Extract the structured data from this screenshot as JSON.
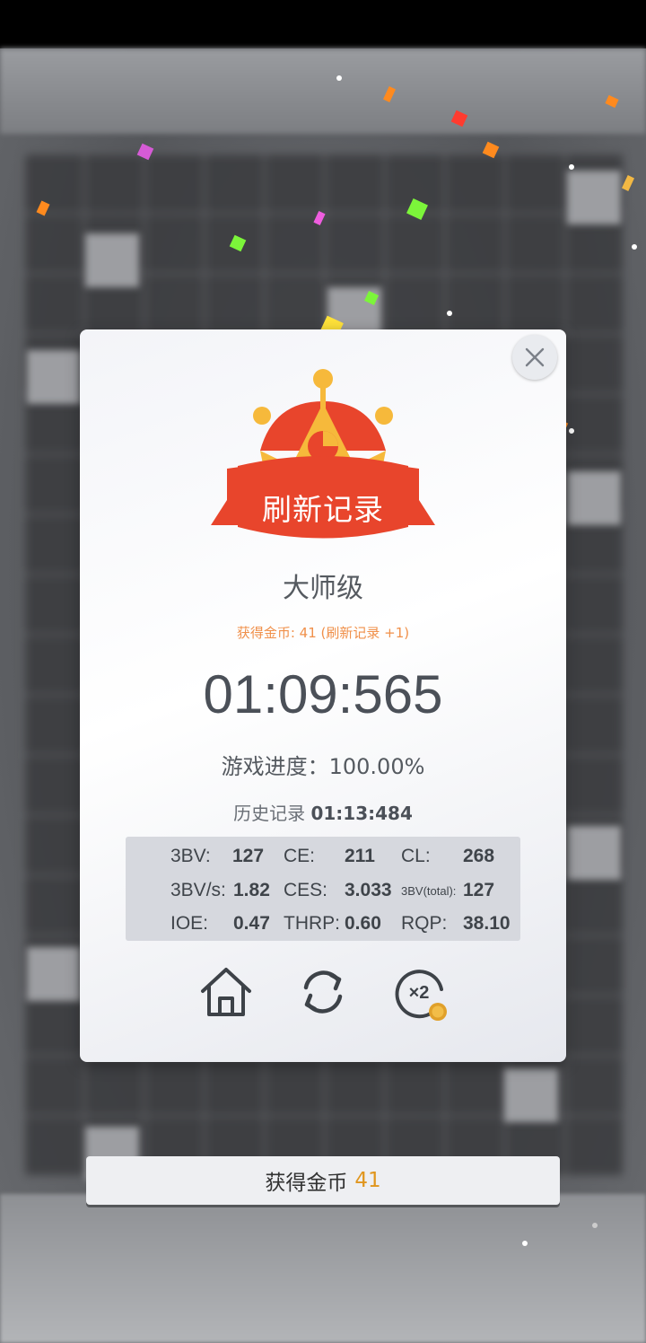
{
  "dialog": {
    "badge": "刷新记录",
    "level": "大师级",
    "coins_earned": "获得金币: 41 (刷新记录 +1)",
    "time": "01:09:565",
    "progress": "游戏进度：100.00%",
    "history_label": "历史记录",
    "history_value": "01:13:484",
    "stats": {
      "bv_label": "3BV:",
      "bv_value": "127",
      "ce_label": "CE:",
      "ce_value": "211",
      "cl_label": "CL:",
      "cl_value": "268",
      "bvs_label": "3BV/s:",
      "bvs_value": "1.82",
      "ces_label": "CES:",
      "ces_value": "3.033",
      "bvtotal_label": "3BV(total):",
      "bvtotal_value": "127",
      "ioe_label": "IOE:",
      "ioe_value": "0.47",
      "thrp_label": "THRP:",
      "thrp_value": "0.60",
      "rqp_label": "RQP:",
      "rqp_value": "38.10"
    },
    "actions": {
      "home_icon": "home-icon",
      "restart_icon": "refresh-icon",
      "double_icon": "x2-coin-icon",
      "double_label": "×2"
    }
  },
  "reward_bar": {
    "label": "获得金币",
    "amount": "41"
  },
  "colors": {
    "accent_orange": "#f0904a",
    "badge_red": "#e8452c",
    "crown_gold": "#f6b93b",
    "coin_gold": "#e0961e"
  }
}
